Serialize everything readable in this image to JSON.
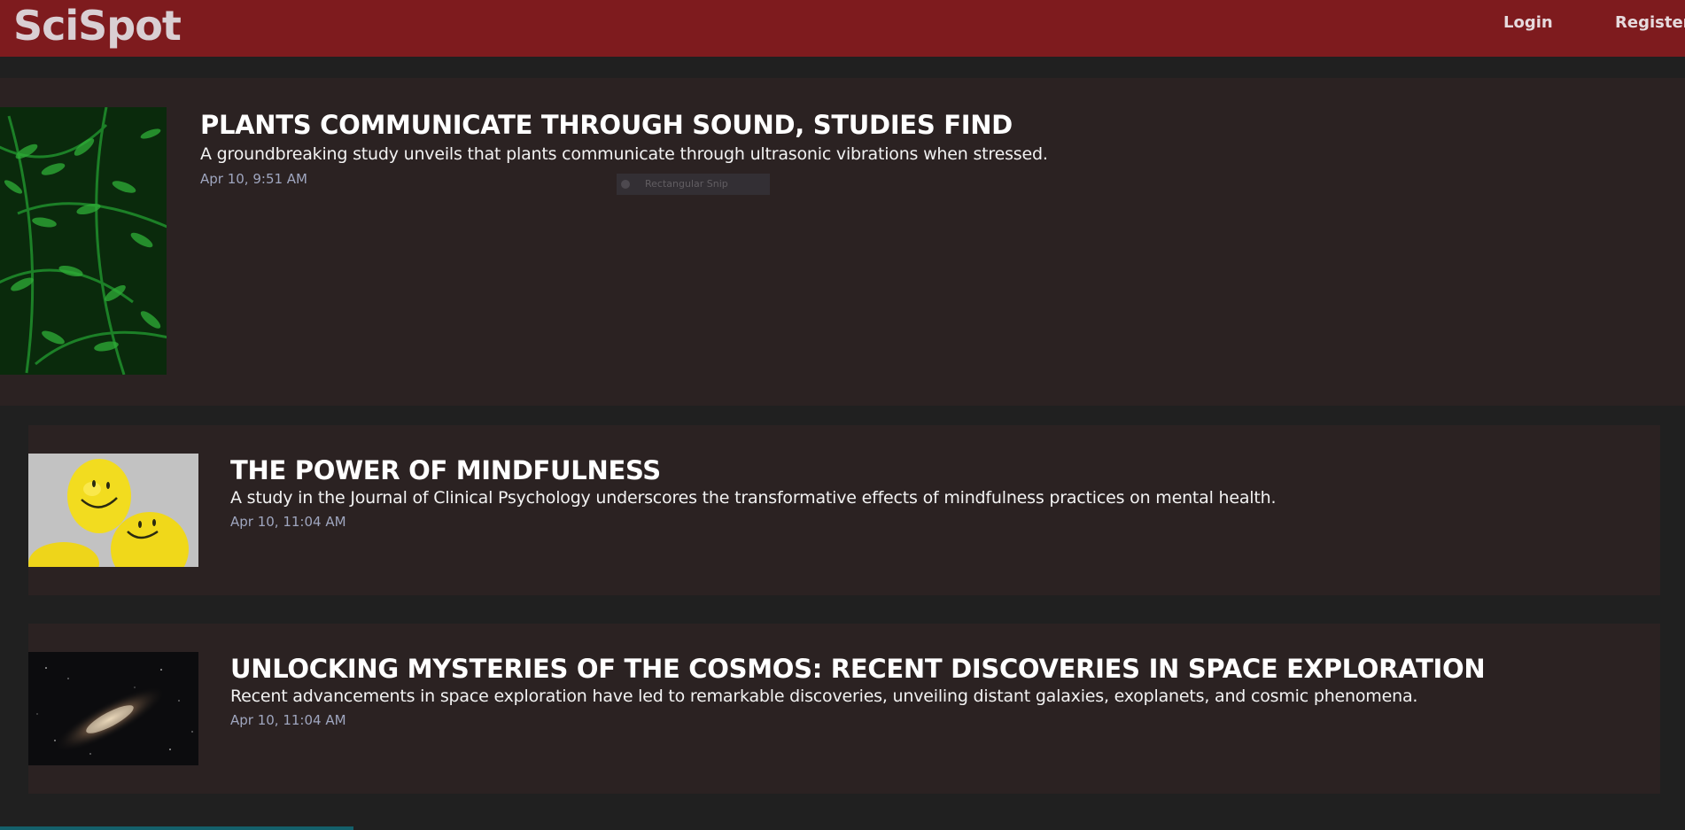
{
  "header": {
    "brand": "SciSpot",
    "nav": {
      "login_label": "Login",
      "register_label": "Register"
    }
  },
  "articles": [
    {
      "title": "PLANTS COMMUNICATE THROUGH SOUND, STUDIES FIND",
      "summary": "A groundbreaking study unveils that plants communicate through ultrasonic vibrations when stressed.",
      "date": "Apr 10, 9:51 AM",
      "image": "fern-leaves-photo"
    },
    {
      "title": "THE POWER OF MINDFULNESS",
      "summary": "A study in the Journal of Clinical Psychology underscores the transformative effects of mindfulness practices on mental health.",
      "date": "Apr 10, 11:04 AM",
      "image": "smiley-balloons-photo"
    },
    {
      "title": "UNLOCKING MYSTERIES OF THE COSMOS: RECENT DISCOVERIES IN SPACE EXPLORATION",
      "summary": "Recent advancements in space exploration have led to remarkable discoveries, unveiling distant galaxies, exoplanets, and cosmic phenomena.",
      "date": "Apr 10, 11:04 AM",
      "image": "milky-way-photo"
    }
  ],
  "overlay": {
    "snip_label": "Rectangular Snip"
  },
  "scroll_progress": 0.21,
  "colors": {
    "header_bg": "#7e1b1e",
    "page_bg": "#202020",
    "card_bg": "#2b2222",
    "date_text": "#9fa6bf",
    "progress": "#14606b"
  }
}
